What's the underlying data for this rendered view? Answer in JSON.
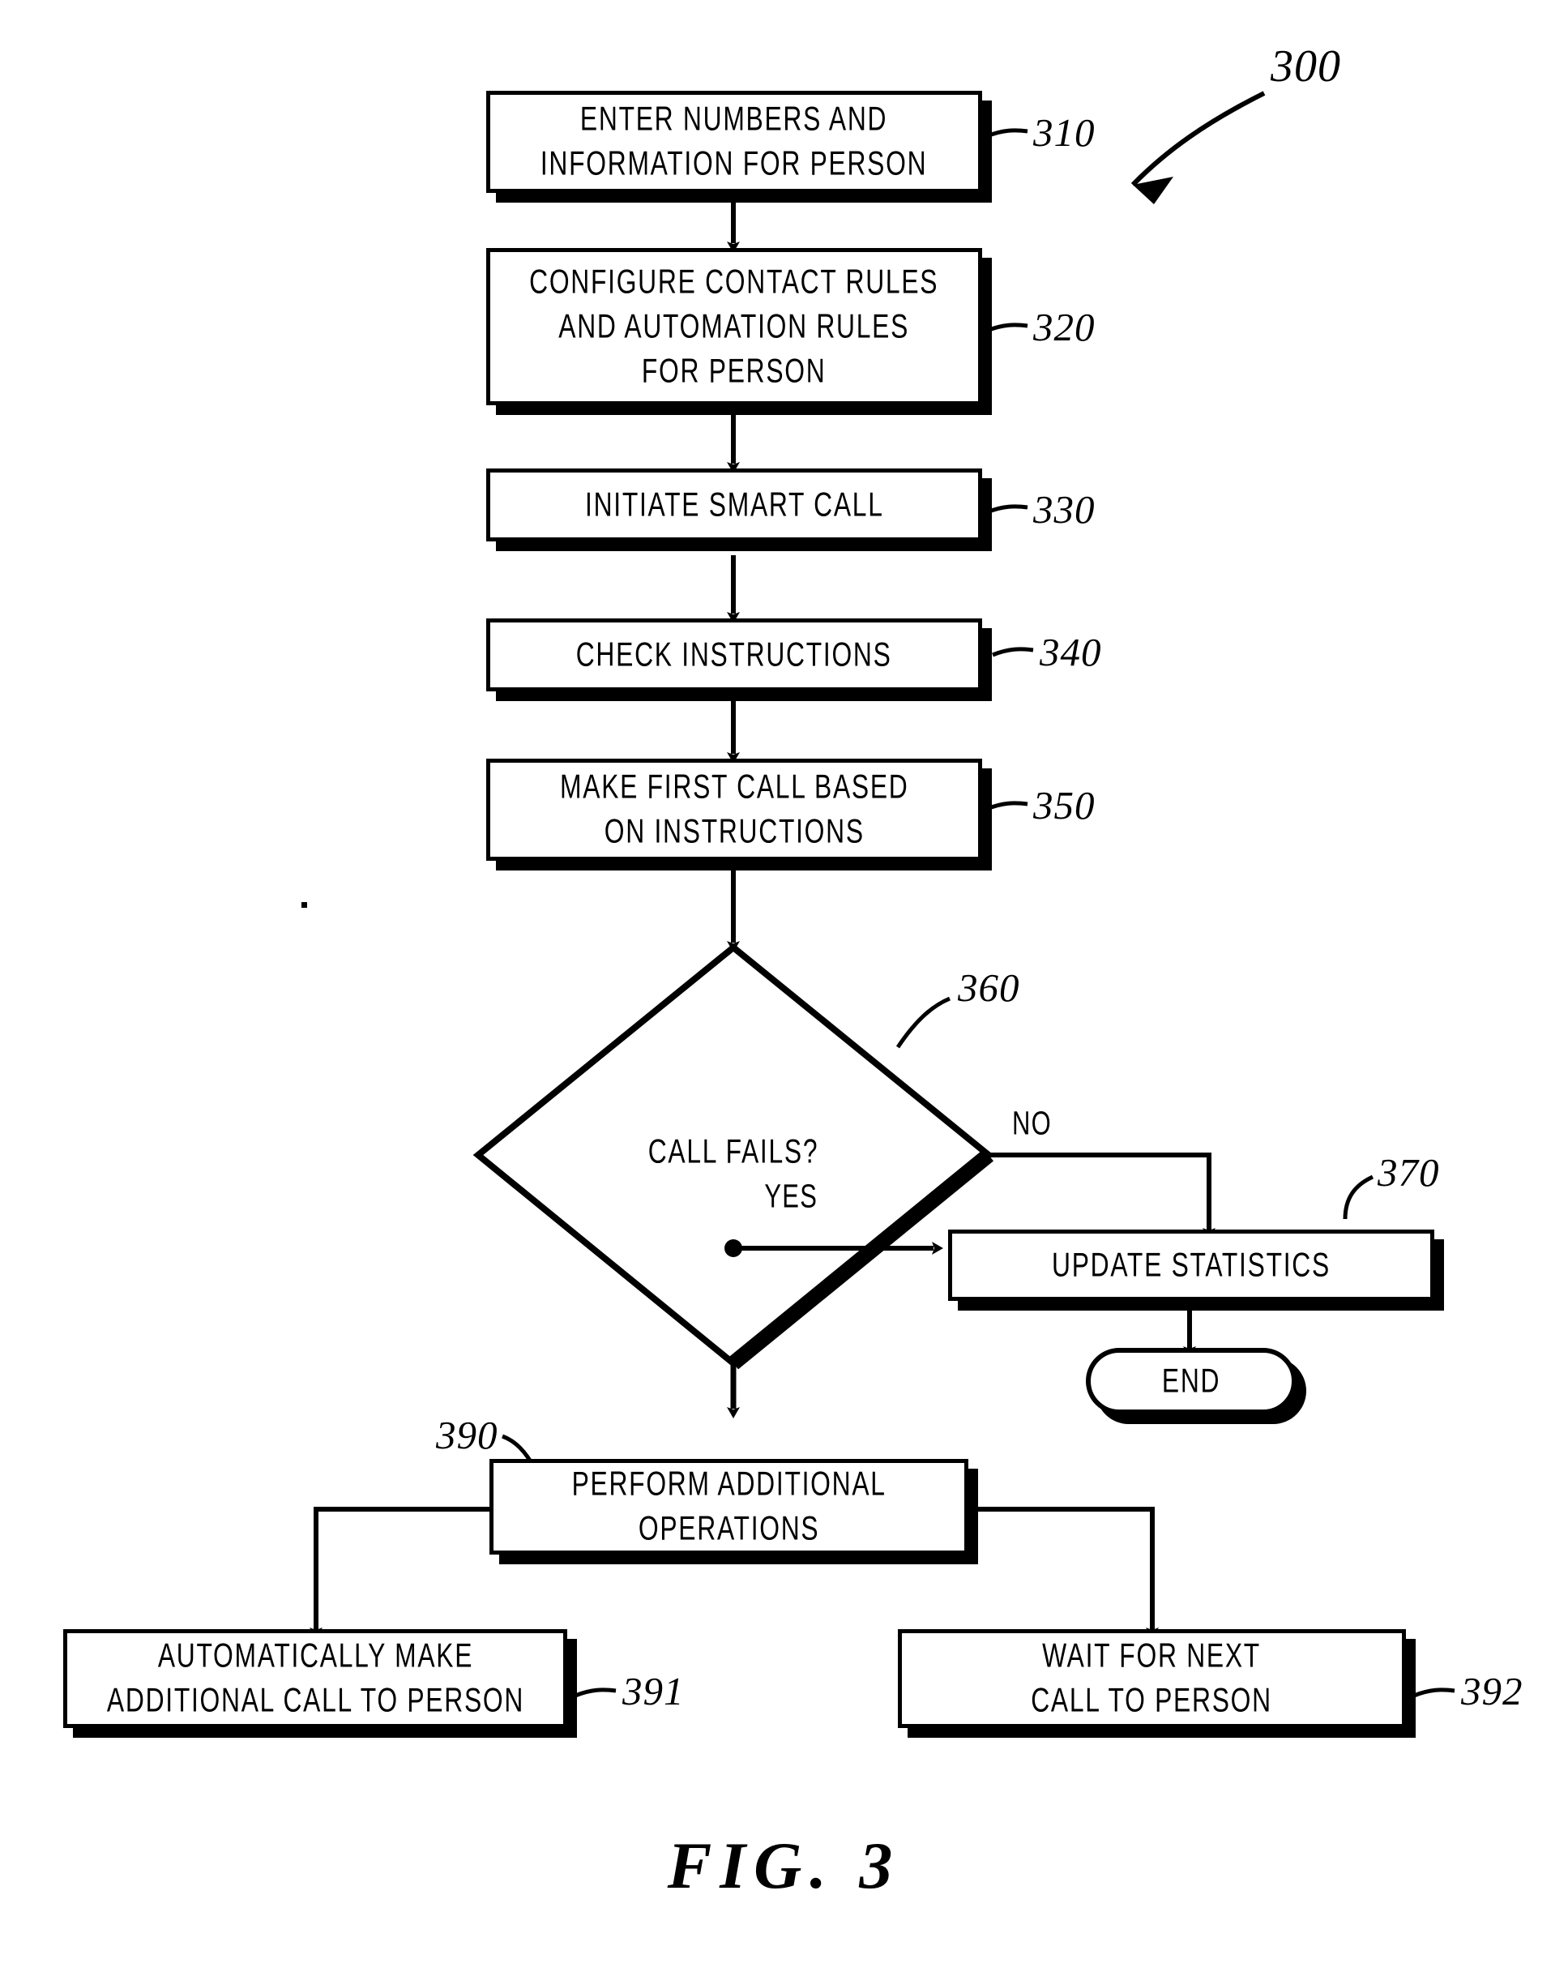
{
  "figure": {
    "caption": "FIG.  3",
    "diagram_ref": "300"
  },
  "nodes": [
    {
      "id": "310",
      "kind": "process",
      "ref": "310",
      "label": "ENTER NUMBERS AND\nINFORMATION FOR PERSON"
    },
    {
      "id": "320",
      "kind": "process",
      "ref": "320",
      "label": "CONFIGURE CONTACT RULES\nAND AUTOMATION RULES\nFOR PERSON"
    },
    {
      "id": "330",
      "kind": "process",
      "ref": "330",
      "label": "INITIATE SMART CALL"
    },
    {
      "id": "340",
      "kind": "process",
      "ref": "340",
      "label": "CHECK INSTRUCTIONS"
    },
    {
      "id": "350",
      "kind": "process",
      "ref": "350",
      "label": "MAKE FIRST CALL BASED\nON INSTRUCTIONS"
    },
    {
      "id": "360",
      "kind": "decision",
      "ref": "360",
      "label": "CALL FAILS?"
    },
    {
      "id": "370",
      "kind": "process",
      "ref": "370",
      "label": "UPDATE STATISTICS"
    },
    {
      "id": "end",
      "kind": "terminator",
      "ref": "",
      "label": "END"
    },
    {
      "id": "390",
      "kind": "process",
      "ref": "390",
      "label": "PERFORM ADDITIONAL\nOPERATIONS"
    },
    {
      "id": "391",
      "kind": "process",
      "ref": "391",
      "label": "AUTOMATICALLY MAKE\nADDITIONAL CALL TO PERSON"
    },
    {
      "id": "392",
      "kind": "process",
      "ref": "392",
      "label": "WAIT FOR NEXT\nCALL TO PERSON"
    }
  ],
  "edge_labels": {
    "no": "NO",
    "yes": "YES"
  },
  "colors": {
    "ink": "#000000",
    "paper": "#ffffff"
  }
}
